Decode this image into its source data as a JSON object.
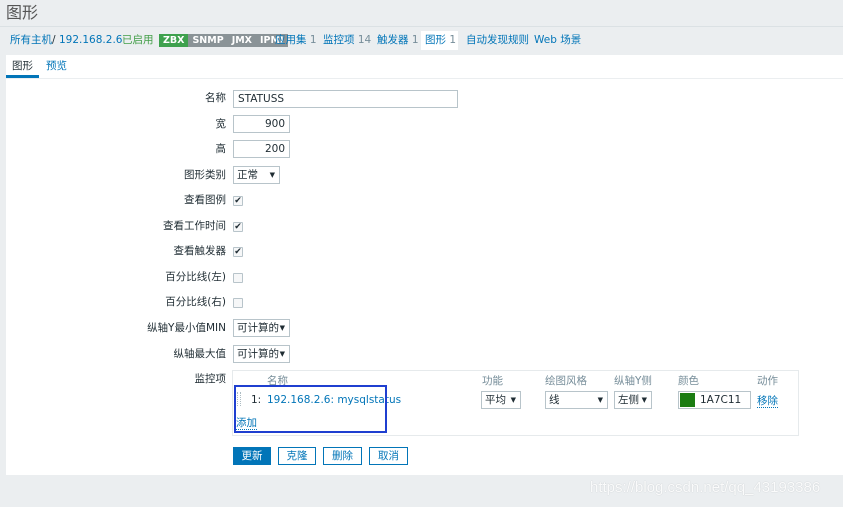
{
  "page": {
    "title": "图形"
  },
  "breadcrumb": {
    "all_hosts": "所有主机",
    "separator": "/",
    "host": "192.168.2.6",
    "status": "已启用",
    "availability": [
      {
        "label": "ZBX",
        "state": "available"
      },
      {
        "label": "SNMP",
        "state": "unknown"
      },
      {
        "label": "JMX",
        "state": "unknown"
      },
      {
        "label": "IPMI",
        "state": "unknown"
      }
    ],
    "links": [
      {
        "label": "应用集",
        "count": "1"
      },
      {
        "label": "监控项",
        "count": "14"
      },
      {
        "label": "触发器",
        "count": "1"
      },
      {
        "label": "图形",
        "count": "1",
        "active": true
      },
      {
        "label": "自动发现规则"
      },
      {
        "label": "Web 场景"
      }
    ]
  },
  "tabs": [
    {
      "label": "图形",
      "active": true
    },
    {
      "label": "预览",
      "active": false
    }
  ],
  "form": {
    "name": {
      "label": "名称",
      "value": "STATUSS"
    },
    "width": {
      "label": "宽",
      "value": "900"
    },
    "height": {
      "label": "高",
      "value": "200"
    },
    "graph_type": {
      "label": "图形类别",
      "value": "正常"
    },
    "show_legend": {
      "label": "查看图例",
      "checked": true
    },
    "show_working_time": {
      "label": "查看工作时间",
      "checked": true
    },
    "show_triggers": {
      "label": "查看触发器",
      "checked": true
    },
    "percentile_left": {
      "label": "百分比线(左)",
      "checked": false
    },
    "percentile_right": {
      "label": "百分比线(右)",
      "checked": false
    },
    "ymin": {
      "label": "纵轴Y最小值MIN",
      "value": "可计算的"
    },
    "ymax": {
      "label": "纵轴最大值",
      "value": "可计算的"
    },
    "items": {
      "label": "监控项",
      "columns": {
        "name": "名称",
        "function": "功能",
        "draw_style": "绘图风格",
        "y_axis_side": "纵轴Y侧",
        "color": "颜色",
        "action": "动作"
      },
      "rows": [
        {
          "index": "1:",
          "name": "192.168.2.6: mysqlstatus",
          "function": "平均",
          "draw_style": "线",
          "y_axis_side": "左侧",
          "color": "1A7C11",
          "action": "移除"
        }
      ],
      "add_label": "添加"
    }
  },
  "buttons": {
    "update": "更新",
    "clone": "克隆",
    "delete": "删除",
    "cancel": "取消"
  },
  "colors": {
    "accent": "#0275b8",
    "enabled": "#429e47",
    "item_color": "#1A7C11",
    "highlight": "#1f3fd0"
  },
  "watermark": "https://blog.csdn.net/qq_43193386"
}
